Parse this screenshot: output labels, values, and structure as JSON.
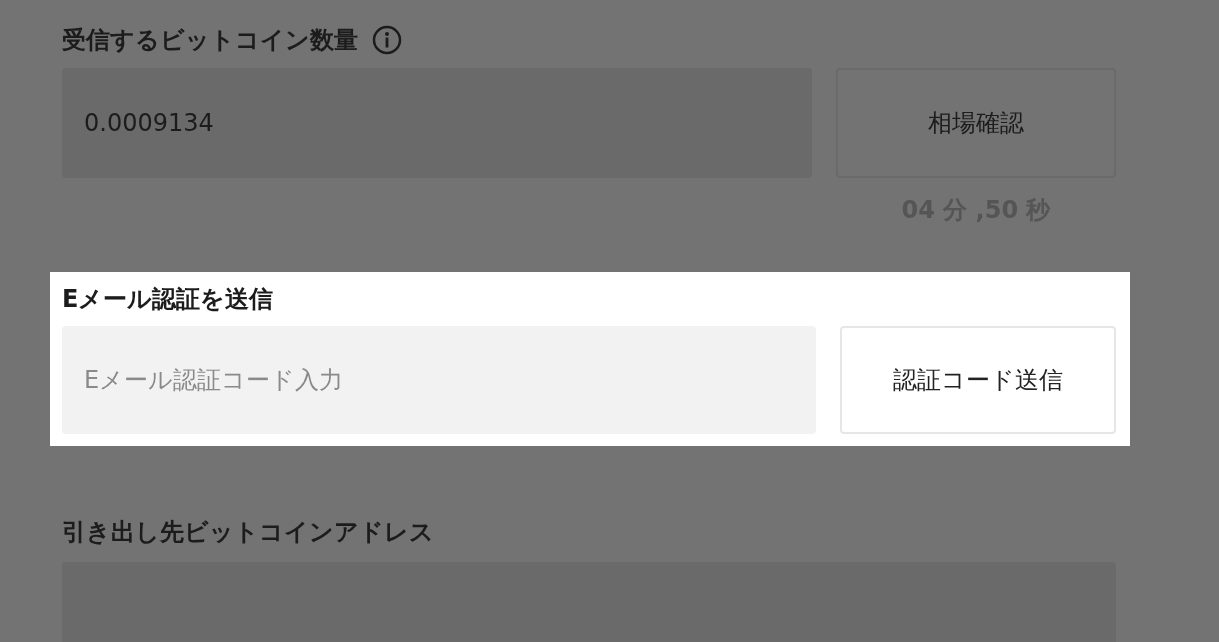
{
  "amount": {
    "label": "受信するビットコイン数量",
    "value": "0.0009134",
    "button": "相場確認",
    "timer": "04 分 ,50 秒"
  },
  "email": {
    "label": "Eメール認証を送信",
    "placeholder": "Eメール認証コード入力",
    "button": "認証コード送信",
    "highlighted": true
  },
  "address": {
    "label": "引き出し先ビットコインアドレス"
  }
}
